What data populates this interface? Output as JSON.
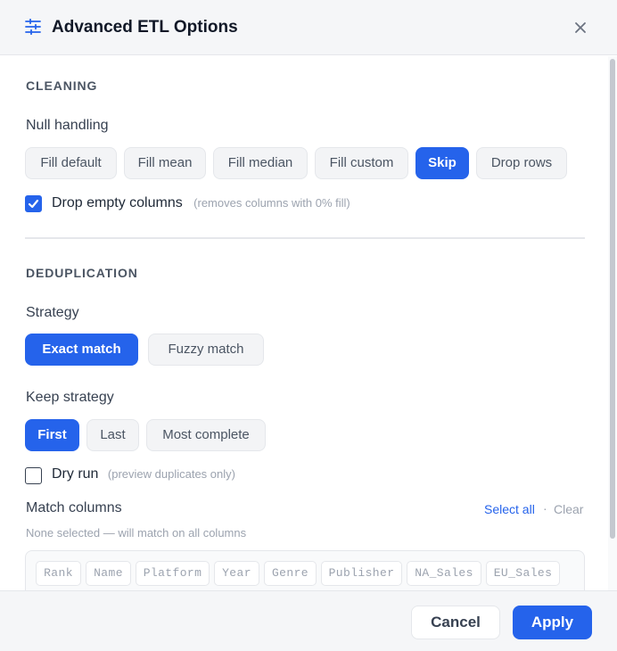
{
  "dialog": {
    "title": "Advanced ETL Options",
    "icon": "sliders-icon",
    "close_icon": "close-icon"
  },
  "cleaning": {
    "section_title": "CLEANING",
    "null_handling_label": "Null handling",
    "options": [
      "Fill default",
      "Fill mean",
      "Fill median",
      "Fill custom",
      "Skip",
      "Drop rows"
    ],
    "selected": "Skip",
    "drop_empty": {
      "label": "Drop empty columns",
      "hint": "(removes columns with 0% fill)",
      "checked": true
    }
  },
  "deduplication": {
    "section_title": "DEDUPLICATION",
    "strategy_label": "Strategy",
    "strategy_options": [
      "Exact match",
      "Fuzzy match"
    ],
    "strategy_selected": "Exact match",
    "keep_label": "Keep strategy",
    "keep_options": [
      "First",
      "Last",
      "Most complete"
    ],
    "keep_selected": "First",
    "dry_run": {
      "label": "Dry run",
      "hint": "(preview duplicates only)",
      "checked": false
    },
    "match_columns": {
      "label": "Match columns",
      "select_all": "Select all",
      "separator": "·",
      "clear": "Clear",
      "status": "None selected — will match on all columns",
      "columns": [
        "Rank",
        "Name",
        "Platform",
        "Year",
        "Genre",
        "Publisher",
        "NA_Sales",
        "EU_Sales"
      ]
    }
  },
  "footer": {
    "cancel": "Cancel",
    "apply": "Apply"
  },
  "colors": {
    "accent": "#2563eb",
    "muted_text": "#9ca3af",
    "pill_bg": "#f3f4f6"
  }
}
